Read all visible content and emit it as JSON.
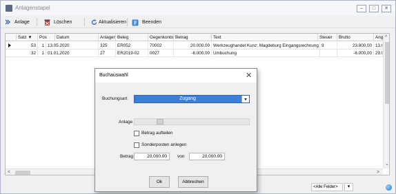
{
  "window": {
    "title": "Anlagenstapel",
    "controls": [
      "minimize",
      "maximize",
      "close"
    ]
  },
  "toolbar": {
    "items": [
      {
        "label": "Anlage",
        "icon": "add-icon"
      },
      {
        "label": "Löschen",
        "icon": "delete-icon"
      },
      {
        "label": "Aktualisieren",
        "icon": "refresh-icon"
      },
      {
        "label": "Beenden",
        "icon": "exit-icon"
      }
    ]
  },
  "grid": {
    "columns": [
      "Satz ▼",
      "Pos",
      "Datum",
      "Anlagen",
      "Beleg",
      "Gegenkonto",
      "Betrag",
      "Text",
      "Steuer",
      "Brutto",
      "Ang"
    ],
    "rows": [
      [
        "53",
        "1",
        "13.05.2020",
        "325",
        "ER052",
        "70002",
        "20.000,00",
        "Werkzeughandel Kunz; Magdeburg Eingangsrechnung",
        "9",
        "23.800,00",
        "13.0"
      ],
      [
        "32",
        "1",
        "01.01.2020",
        "27",
        "ER2019-02",
        "0027",
        "-6.000,00",
        "Umbuchung",
        "",
        "-6.000,00",
        "29.0"
      ]
    ],
    "current_row": 0
  },
  "status": {
    "filter": "<Alle Felder>"
  },
  "dialog": {
    "title": "Buchauswahl",
    "buchungsart_label": "Buchungsart",
    "buchungsart_value": "Zugang",
    "anlage_label": "Anlage",
    "betrag_aufteilen_label": "Betrag aufteilen",
    "betrag_aufteilen_checked": false,
    "sonderposten_label": "Sonderposten anlegen",
    "sonderposten_checked": false,
    "betrag_label": "Betrag",
    "betrag_value": "20.000,00",
    "von_label": "von",
    "von_value": "20.000,00",
    "ok_label": "Ok",
    "cancel_label": "Abbrechen"
  },
  "colors": {
    "selection_blue": "#3b7fd9",
    "window_bg": "#f0f0f0"
  }
}
